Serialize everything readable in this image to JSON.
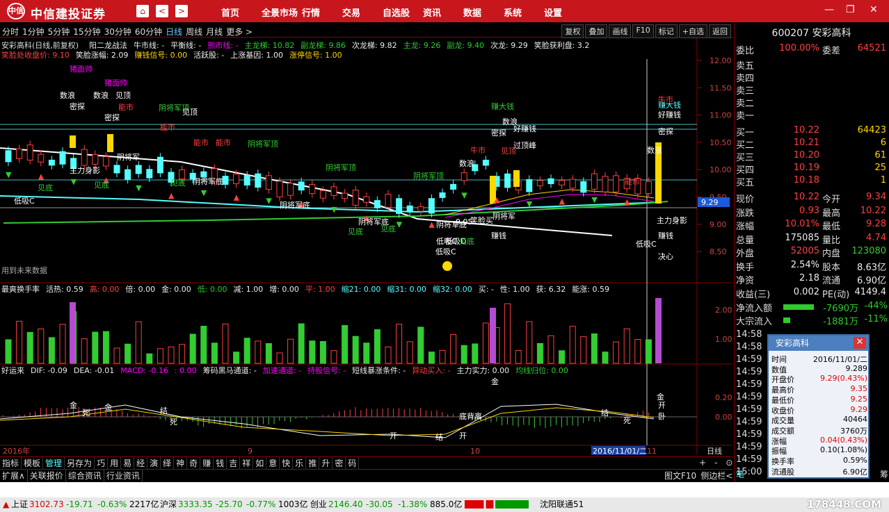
{
  "app": {
    "logo": "中信",
    "name": "中信建投证券",
    "menu": [
      "首页",
      "全景市场",
      "行情",
      "交易",
      "自选股",
      "资讯",
      "数据",
      "系统",
      "设置"
    ],
    "back": "<",
    "fwd": ">",
    "home": "⌂"
  },
  "periods": [
    "分时",
    "1分钟",
    "5分钟",
    "15分钟",
    "30分钟",
    "60分钟",
    "日线",
    "周线",
    "月线",
    "更多 >"
  ],
  "active_period": "日线",
  "tools": [
    "复权",
    "叠加",
    "画线",
    "F10",
    "标记",
    "+自选",
    "返回"
  ],
  "chart": {
    "title": "安彩高科(日线,前复权)",
    "ind1": [
      {
        "t": "阳二龙战法",
        "c": "#eee"
      },
      {
        "t": "牛市线: -",
        "c": "#eee"
      },
      {
        "t": "平衡线: -",
        "c": "#eee"
      },
      {
        "t": "熊市线: -",
        "c": "#f0f"
      },
      {
        "t": "主龙梯: 10.82",
        "c": "#2ecc2e"
      },
      {
        "t": "副龙梯: 9.86",
        "c": "#2ecc2e"
      },
      {
        "t": "次龙梯: 9.82",
        "c": "#eee"
      },
      {
        "t": "主龙: 9.26",
        "c": "#2ecc2e"
      },
      {
        "t": "副龙: 9.40",
        "c": "#2ecc2e"
      },
      {
        "t": "次龙: 9.29",
        "c": "#eee"
      },
      {
        "t": "笑脸获利盘: 3.2",
        "c": "#eee"
      }
    ],
    "ind2": [
      {
        "t": "笑脸处收盘价: 9.10",
        "c": "#ff4040"
      },
      {
        "t": "笑脸涨幅: 2.09",
        "c": "#eee"
      },
      {
        "t": "赚钱信号: 0.00",
        "c": "#ffd700"
      },
      {
        "t": "活跃股: -",
        "c": "#eee"
      },
      {
        "t": "上涨基因: 1.00",
        "c": "#eee"
      },
      {
        "t": "涨停信号: 1.00",
        "c": "#ffd700"
      }
    ],
    "price_axis": [
      "12.00",
      "11.50",
      "11.00",
      "10.50",
      "10.00",
      "9.50",
      "9.00",
      "8.50"
    ],
    "current_marker": "9.29",
    "note": "用到未来数据",
    "labels": [
      "猪面帅",
      "猪面帅",
      "数浪",
      "数浪",
      "见顶",
      "密探",
      "密探",
      "能市",
      "阴将军顶",
      "见顶",
      "能市",
      "能市",
      "能市",
      "阴将军顶",
      "阴将军顶",
      "阴将军顶",
      "阴将军",
      "阴将军底",
      "主力身影",
      "见底",
      "见底",
      "见底",
      "低吸C",
      "阴将军底",
      "阴将军底",
      "见底",
      "见底",
      "阴将军底",
      "低吸C",
      "低吸C",
      "低吸D",
      "见底",
      "数浪",
      "赚大钱",
      "数浪",
      "密探",
      "好赚钱",
      "过顶峰",
      "见顶",
      "牛市",
      "赚钱",
      "笑脸买",
      "阴将军",
      "数浪",
      "赚大钱",
      "好赚钱",
      "密探",
      "主力身影",
      "低吸C",
      "决心",
      "赚钱",
      "能市",
      "牛市",
      "9.05"
    ],
    "vol_ind": [
      {
        "t": "最爽换手率",
        "c": "#eee"
      },
      {
        "t": "活热: 0.59",
        "c": "#eee"
      },
      {
        "t": "高: 0.00",
        "c": "#ff4040"
      },
      {
        "t": "倍: 0.00",
        "c": "#eee"
      },
      {
        "t": "金: 0.00",
        "c": "#eee"
      },
      {
        "t": "低: 0.00",
        "c": "#2ecc2e"
      },
      {
        "t": "减: 1.00",
        "c": "#eee"
      },
      {
        "t": "增: 0.00",
        "c": "#eee"
      },
      {
        "t": "平: 1.00",
        "c": "#ff4040"
      },
      {
        "t": "缩21: 0.00",
        "c": "#5ff"
      },
      {
        "t": "缩31: 0.00",
        "c": "#5ff"
      },
      {
        "t": "缩32: 0.00",
        "c": "#5ff"
      },
      {
        "t": "买: -",
        "c": "#eee"
      },
      {
        "t": "性: 1.00",
        "c": "#eee"
      },
      {
        "t": "获: 6.32",
        "c": "#eee"
      },
      {
        "t": "能涨: 0.59",
        "c": "#eee"
      }
    ],
    "vol_axis": [
      "2.00",
      "1.00"
    ],
    "macd_ind": [
      {
        "t": "好运来",
        "c": "#eee"
      },
      {
        "t": "DIF: -0.09",
        "c": "#eee"
      },
      {
        "t": "DEA: -0.01",
        "c": "#eee"
      },
      {
        "t": "MACD: -0.16",
        "c": "#f0f"
      },
      {
        "t": ": 0.00",
        "c": "#f0f"
      },
      {
        "t": "筹码黑马通道: -",
        "c": "#eee"
      },
      {
        "t": "加速通道: -",
        "c": "#f0f"
      },
      {
        "t": "持股信号: -",
        "c": "#f0f"
      },
      {
        "t": "短线暴涨条件: -",
        "c": "#eee"
      },
      {
        "t": "异动买入: -",
        "c": "#ff4040"
      },
      {
        "t": "主力实力: 0.00",
        "c": "#eee"
      },
      {
        "t": "均线归位: 0.00",
        "c": "#2ecc2e"
      }
    ],
    "macd_axis": [
      "0.20",
      "0.00"
    ],
    "macd_labels": [
      "金",
      "死",
      "金",
      "结",
      "死",
      "底背离",
      "开",
      "结",
      "开",
      "金",
      "结",
      "死",
      "金",
      "开",
      "卧"
    ],
    "time_axis": [
      "2016年",
      "9",
      "10",
      "11"
    ],
    "cursor_date": "2016/11/01/二",
    "period_label": "日线"
  },
  "quote": {
    "code": "600207",
    "name": "安彩高科",
    "webi_label": "委比",
    "webi": "100.00%",
    "wecha_label": "委差",
    "wecha": "64521",
    "sells": [
      {
        "l": "卖五"
      },
      {
        "l": "卖四"
      },
      {
        "l": "卖三"
      },
      {
        "l": "卖二"
      },
      {
        "l": "卖一"
      }
    ],
    "buys": [
      {
        "l": "买一",
        "p": "10.22",
        "v": "64423"
      },
      {
        "l": "买二",
        "p": "10.21",
        "v": "6"
      },
      {
        "l": "买三",
        "p": "10.20",
        "v": "61"
      },
      {
        "l": "买四",
        "p": "10.19",
        "v": "25"
      },
      {
        "l": "买五",
        "p": "10.18",
        "v": "1"
      }
    ],
    "stats": [
      {
        "l": "现价",
        "v": "10.22",
        "c": "red",
        "l2": "今开",
        "v2": "9.34",
        "c2": "red"
      },
      {
        "l": "涨跌",
        "v": "0.93",
        "c": "red",
        "l2": "最高",
        "v2": "10.22",
        "c2": "red"
      },
      {
        "l": "涨幅",
        "v": "10.01%",
        "c": "red",
        "l2": "最低",
        "v2": "9.28",
        "c2": "red"
      },
      {
        "l": "总量",
        "v": "175085",
        "c": "white",
        "l2": "量比",
        "v2": "4.74",
        "c2": "red"
      },
      {
        "l": "外盘",
        "v": "52005",
        "c": "red",
        "l2": "内盘",
        "v2": "123080",
        "c2": "green"
      },
      {
        "l": "换手",
        "v": "2.54%",
        "c": "white",
        "l2": "股本",
        "v2": "8.63亿",
        "c2": "white"
      },
      {
        "l": "净资",
        "v": "2.18",
        "c": "white",
        "l2": "流通",
        "v2": "6.90亿",
        "c2": "white"
      },
      {
        "l": "收益(三)",
        "v": "0.002",
        "c": "white",
        "l2": "PE(动)",
        "v2": "4149.4",
        "c2": "white"
      }
    ],
    "flow": [
      {
        "l": "净流入额",
        "v": "-7690万",
        "p": "-44%"
      },
      {
        "l": "大宗流入",
        "v": "-1881万",
        "p": "-11%"
      }
    ],
    "times": [
      "14:58",
      "14:58",
      "14:59",
      "14:59",
      "14:59",
      "14:59",
      "14:59",
      "14:59",
      "14:59",
      "14:59",
      "14:59",
      "15:00"
    ],
    "tabs": [
      "笔",
      "价",
      "筹"
    ]
  },
  "popup": {
    "title": "安彩高科",
    "close": "✕",
    "rows": [
      {
        "k": "时间",
        "v": "2016/11/01/二",
        "c": "#000"
      },
      {
        "k": "数值",
        "v": "9.289",
        "c": "#000"
      },
      {
        "k": "开盘价",
        "v": "9.29(0.43%)",
        "c": "#d00"
      },
      {
        "k": "最高价",
        "v": "9.35",
        "c": "#d00"
      },
      {
        "k": "最低价",
        "v": "9.25",
        "c": "#d00"
      },
      {
        "k": "收盘价",
        "v": "9.29",
        "c": "#d00"
      },
      {
        "k": "成交量",
        "v": "40464",
        "c": "#000"
      },
      {
        "k": "成交额",
        "v": "3760万",
        "c": "#000"
      },
      {
        "k": "涨幅",
        "v": "0.04(0.43%)",
        "c": "#d00"
      },
      {
        "k": "振幅",
        "v": "0.10(1.08%)",
        "c": "#000"
      },
      {
        "k": "换手率",
        "v": "0.59%",
        "c": "#000"
      },
      {
        "k": "流通股",
        "v": "6.90亿",
        "c": "#000"
      }
    ]
  },
  "bottom1": [
    "指标",
    "模板",
    "管理",
    "另存为",
    "巧",
    "用",
    "易",
    "经",
    "演",
    "绎",
    "神",
    "奇",
    "赚",
    "钱",
    "吉",
    "祥",
    "如",
    "意",
    "快",
    "乐",
    "推",
    "升",
    "密",
    "码"
  ],
  "bottom2": [
    "扩展∧",
    "关联报价",
    "综合资讯",
    "行业资讯"
  ],
  "bottom_right": [
    "图文F10",
    "侧边栏<"
  ],
  "zoom": [
    "+",
    "-",
    "⊙"
  ],
  "status": {
    "sh_l": "上证",
    "sh": "3102.73",
    "sh_c": "-19.71",
    "sh_p": "-0.63%",
    "sh_a": "2217亿",
    "hs_l": "沪深",
    "hs": "3333.35",
    "hs_c": "-25.70",
    "hs_p": "-0.77%",
    "hs_a": "1003亿",
    "cy_l": "创业",
    "cy": "2146.40",
    "cy_c": "-30.05",
    "cy_p": "-1.38%",
    "cy_a": "885.0亿",
    "server": "沈阳联通51"
  },
  "watermark": "178448.COM"
}
